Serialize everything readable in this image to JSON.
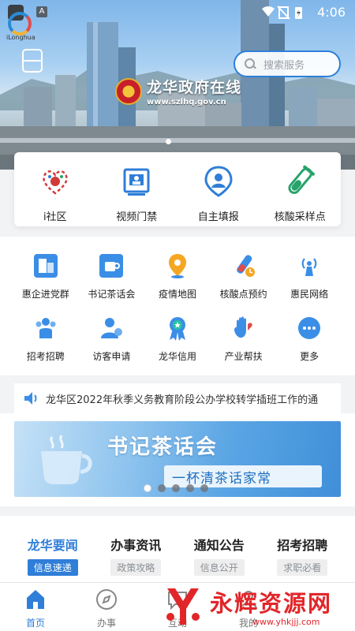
{
  "status_bar": {
    "time": "4:06",
    "app_label": "iLonghua"
  },
  "header": {
    "search_placeholder": "搜索服务",
    "brand_title": "龙华政府在线",
    "brand_url": "www.szlhq.gov.cn"
  },
  "quick_services": [
    {
      "label": "i社区",
      "icon": "community-heart-icon"
    },
    {
      "label": "视频门禁",
      "icon": "video-access-icon"
    },
    {
      "label": "自主填报",
      "icon": "self-report-icon"
    },
    {
      "label": "核酸采样点",
      "icon": "test-tube-icon"
    }
  ],
  "services": [
    {
      "label": "惠企进党群",
      "icon": "party-building-icon"
    },
    {
      "label": "书记茶话会",
      "icon": "tea-talk-icon"
    },
    {
      "label": "疫情地图",
      "icon": "map-pin-icon"
    },
    {
      "label": "核酸点预约",
      "icon": "nucleic-booking-icon"
    },
    {
      "label": "惠民网络",
      "icon": "network-icon"
    },
    {
      "label": "招考招聘",
      "icon": "recruit-icon"
    },
    {
      "label": "访客申请",
      "icon": "visitor-icon"
    },
    {
      "label": "龙华信用",
      "icon": "credit-medal-icon"
    },
    {
      "label": "产业帮扶",
      "icon": "industry-hand-icon"
    },
    {
      "label": "更多",
      "icon": "more-icon"
    }
  ],
  "notice": {
    "text": "龙华区2022年秋季义务教育阶段公办学校转学插班工作的通"
  },
  "banner": {
    "title": "书记茶话会",
    "subtitle": "一杯清茶话家常"
  },
  "news_tabs": [
    {
      "label": "龙华要闻",
      "chip": "信息速递"
    },
    {
      "label": "办事资讯",
      "chip": "政策攻略"
    },
    {
      "label": "通知公告",
      "chip": "信息公开"
    },
    {
      "label": "招考招聘",
      "chip": "求职必看"
    }
  ],
  "bottom_nav": [
    {
      "label": "首页",
      "icon": "home-icon"
    },
    {
      "label": "办事",
      "icon": "compass-icon"
    },
    {
      "label": "互动",
      "icon": "chat-icon"
    },
    {
      "label": "我的",
      "icon": "user-icon"
    }
  ],
  "watermark": {
    "title": "永辉资源网",
    "url": "www.yhkjjj.com"
  },
  "colors": {
    "accent": "#2f7ed8",
    "watermark": "#e1262a"
  }
}
